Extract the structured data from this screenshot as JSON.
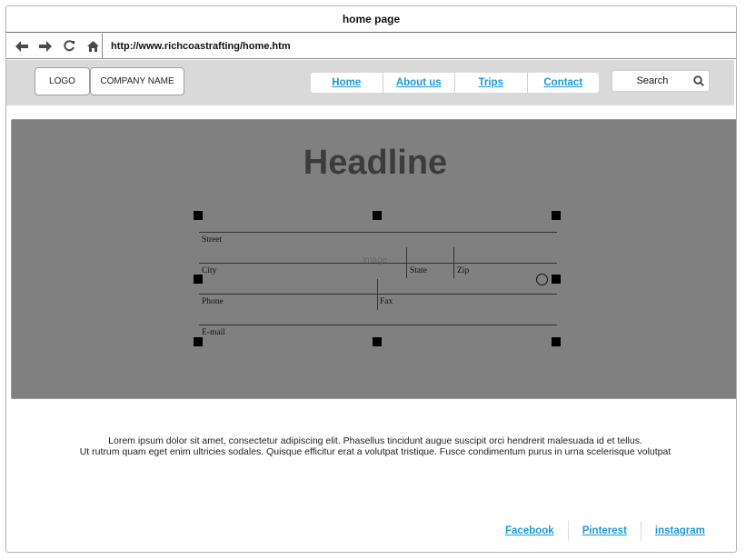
{
  "window": {
    "title": "home page"
  },
  "browser": {
    "url": "http://www.richcoastrafting/home.htm",
    "icons": [
      "back-arrow-icon",
      "forward-arrow-icon",
      "refresh-icon",
      "home-icon"
    ]
  },
  "header": {
    "logo": "LOGO",
    "company_name": "COMPANY NAME",
    "nav": [
      "Home",
      "About us",
      "Trips",
      "Contact"
    ],
    "search_label": "Search",
    "search_icon": "magnifier-icon",
    "background": "#d9d9d9"
  },
  "hero": {
    "headline": "Headline",
    "background": "#808080",
    "image_placeholder": "image",
    "form_labels": {
      "street": "Street",
      "city": "City",
      "state": "State",
      "zip": "Zip",
      "phone": "Phone",
      "fax": "Fax",
      "email": "E-mail"
    }
  },
  "body_text": {
    "line1": "Lorem ipsum dolor sit amet, consectetur adipiscing elit. Phasellus tincidunt augue suscipit orci hendrerit malesuada id et tellus.",
    "line2": "Ut rutrum quam eget enim ultricies sodales. Quisque efficitur erat a volutpat tristique. Fusce condimentum purus in urna scelerisque volutpat"
  },
  "footer": {
    "links": [
      "Facebook",
      "Pinterest",
      "instagram"
    ],
    "link_color": "#1e9ad6"
  }
}
